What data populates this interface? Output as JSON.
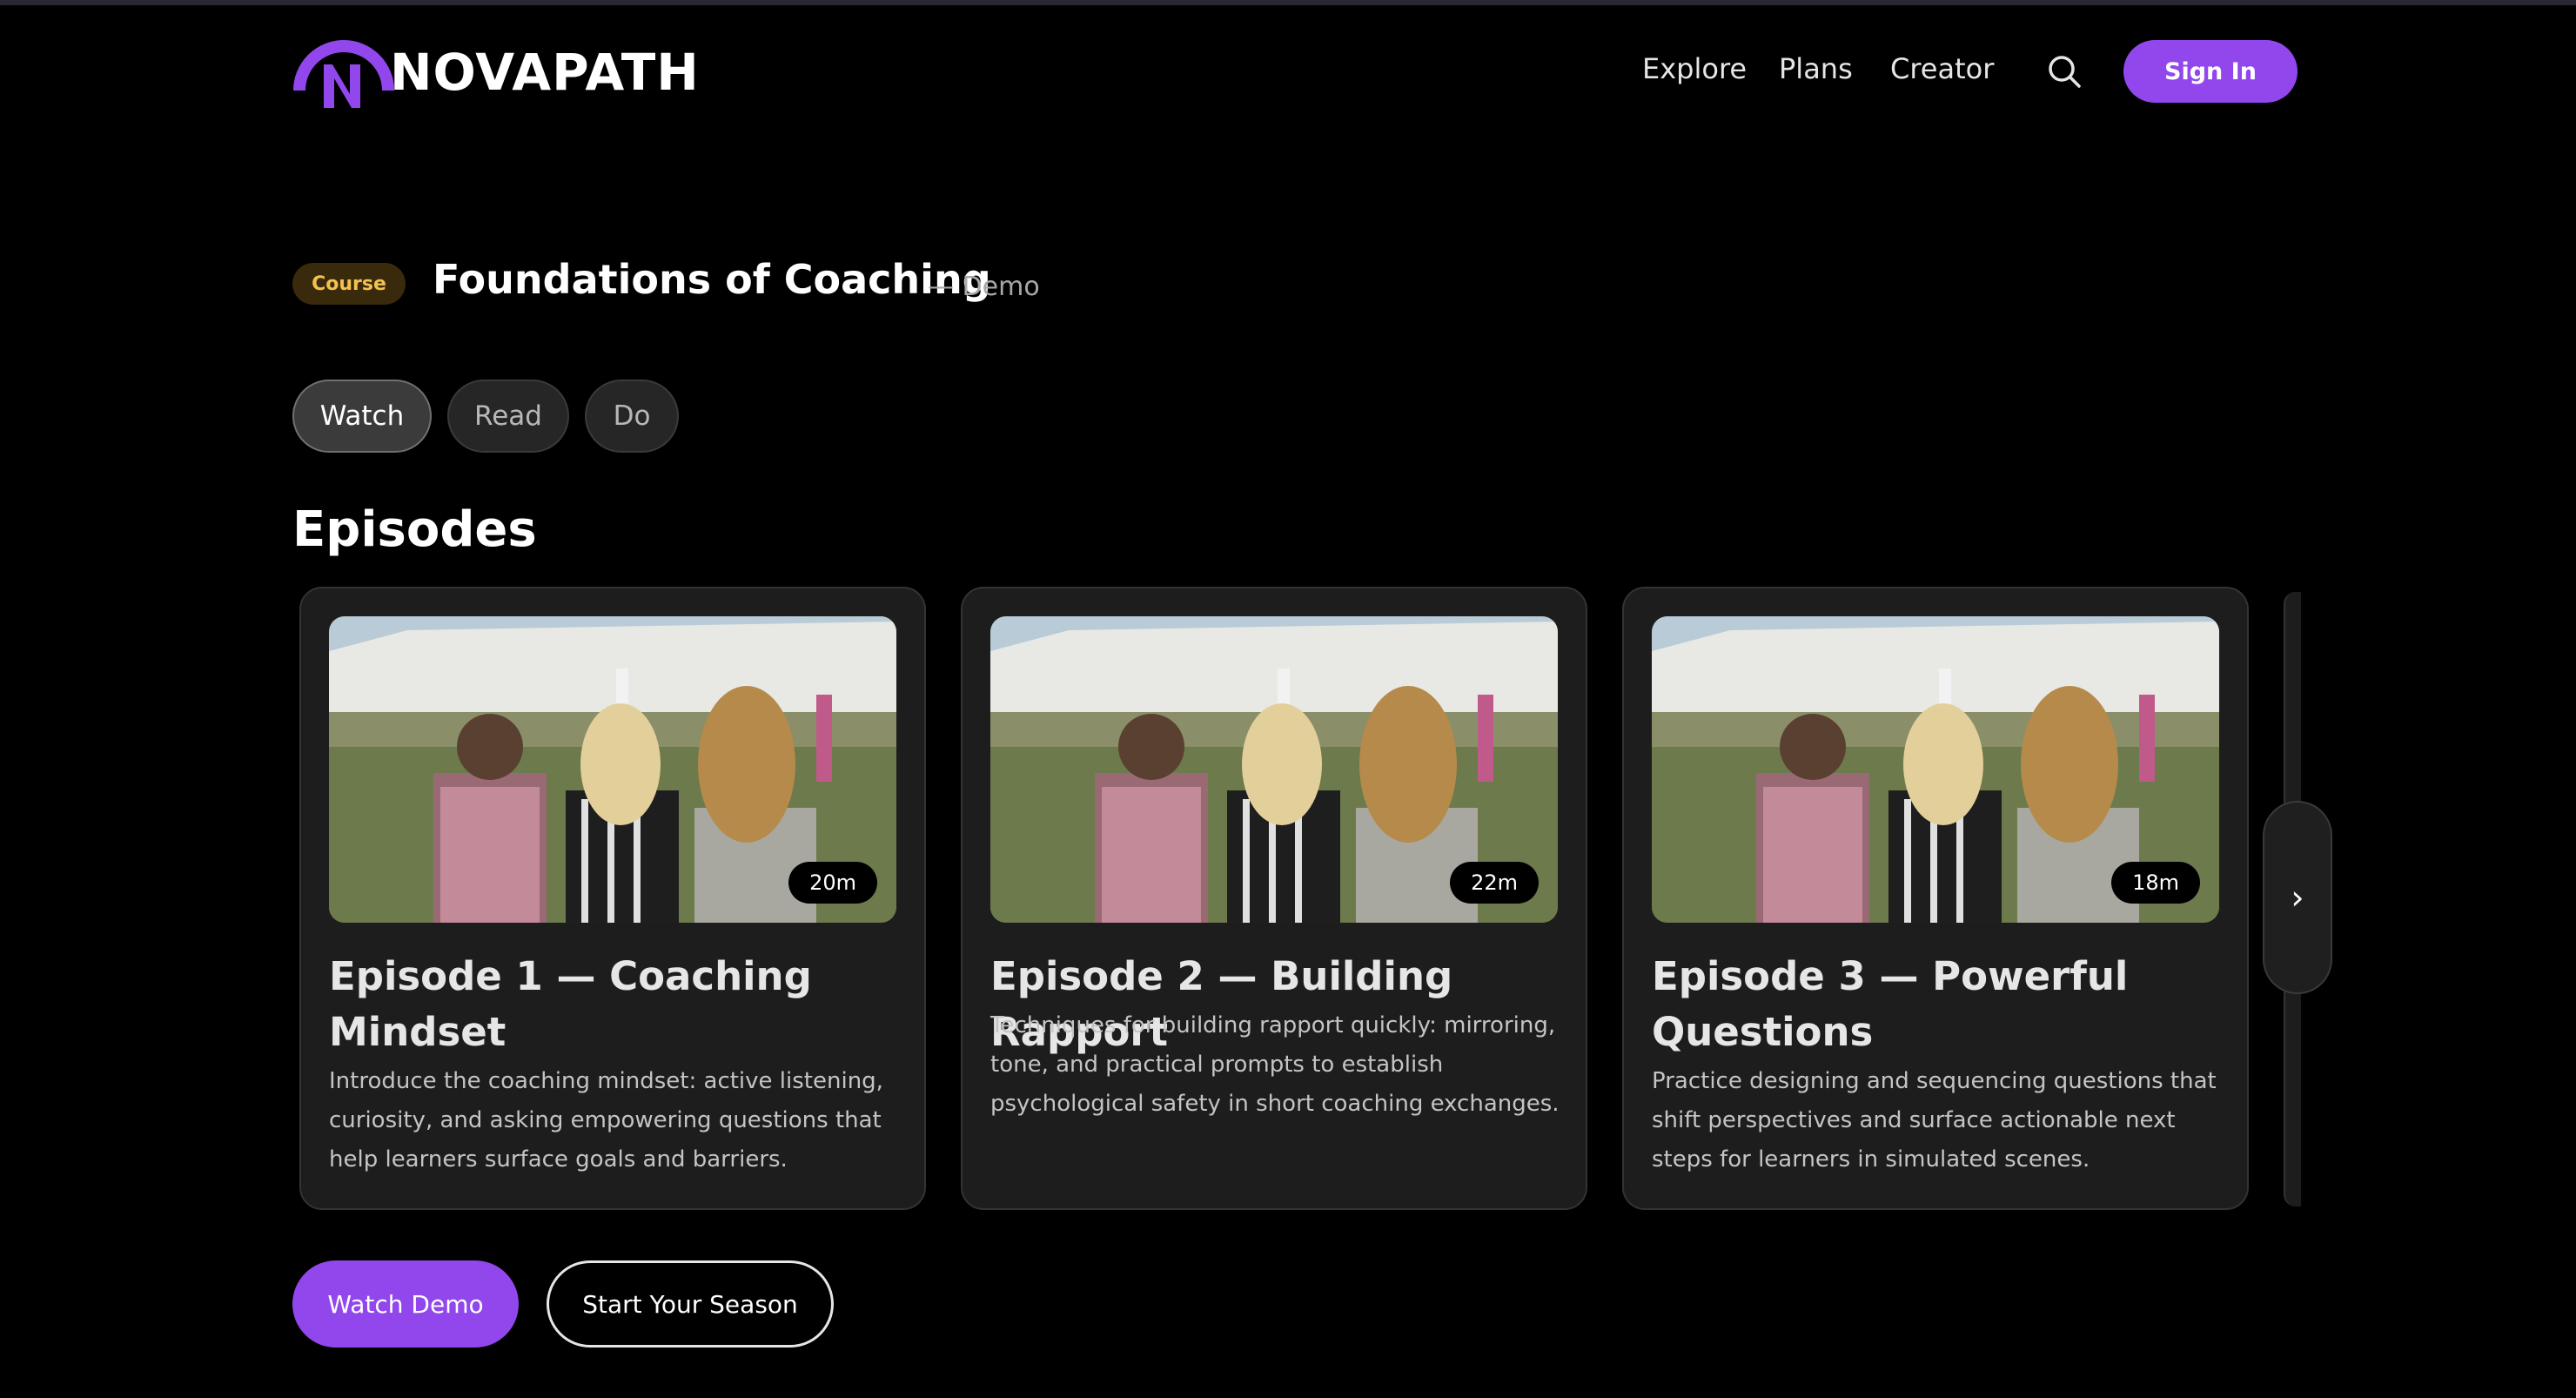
{
  "brand": {
    "name": "NOVAPATH",
    "accent": "#9147ec"
  },
  "nav": {
    "links": [
      "Explore",
      "Plans",
      "Creator"
    ],
    "search_icon": "search-icon",
    "sign_in": "Sign In"
  },
  "course": {
    "badge": "Course",
    "title": "Foundations of Coaching",
    "subtitle": "— Demo"
  },
  "tabs": [
    {
      "label": "Watch",
      "active": true
    },
    {
      "label": "Read",
      "active": false
    },
    {
      "label": "Do",
      "active": false
    }
  ],
  "episodes": {
    "heading": "Episodes",
    "items": [
      {
        "duration": "20m",
        "title": "Episode 1 — Coaching Mindset",
        "description": "Introduce the coaching mindset: active listening, curiosity, and asking empowering questions that help learners surface goals and barriers."
      },
      {
        "duration": "22m",
        "title": "Episode 2 — Building Rapport",
        "description": "Techniques for building rapport quickly: mirroring, tone, and practical prompts to establish psychological safety in short coaching exchanges."
      },
      {
        "duration": "18m",
        "title": "Episode 3 — Powerful Questions",
        "description": "Practice designing and sequencing questions that shift perspectives and surface actionable next steps for learners in simulated scenes."
      }
    ],
    "next_symbol": "›"
  },
  "cta": {
    "primary": "Watch Demo",
    "secondary": "Start Your Season"
  }
}
